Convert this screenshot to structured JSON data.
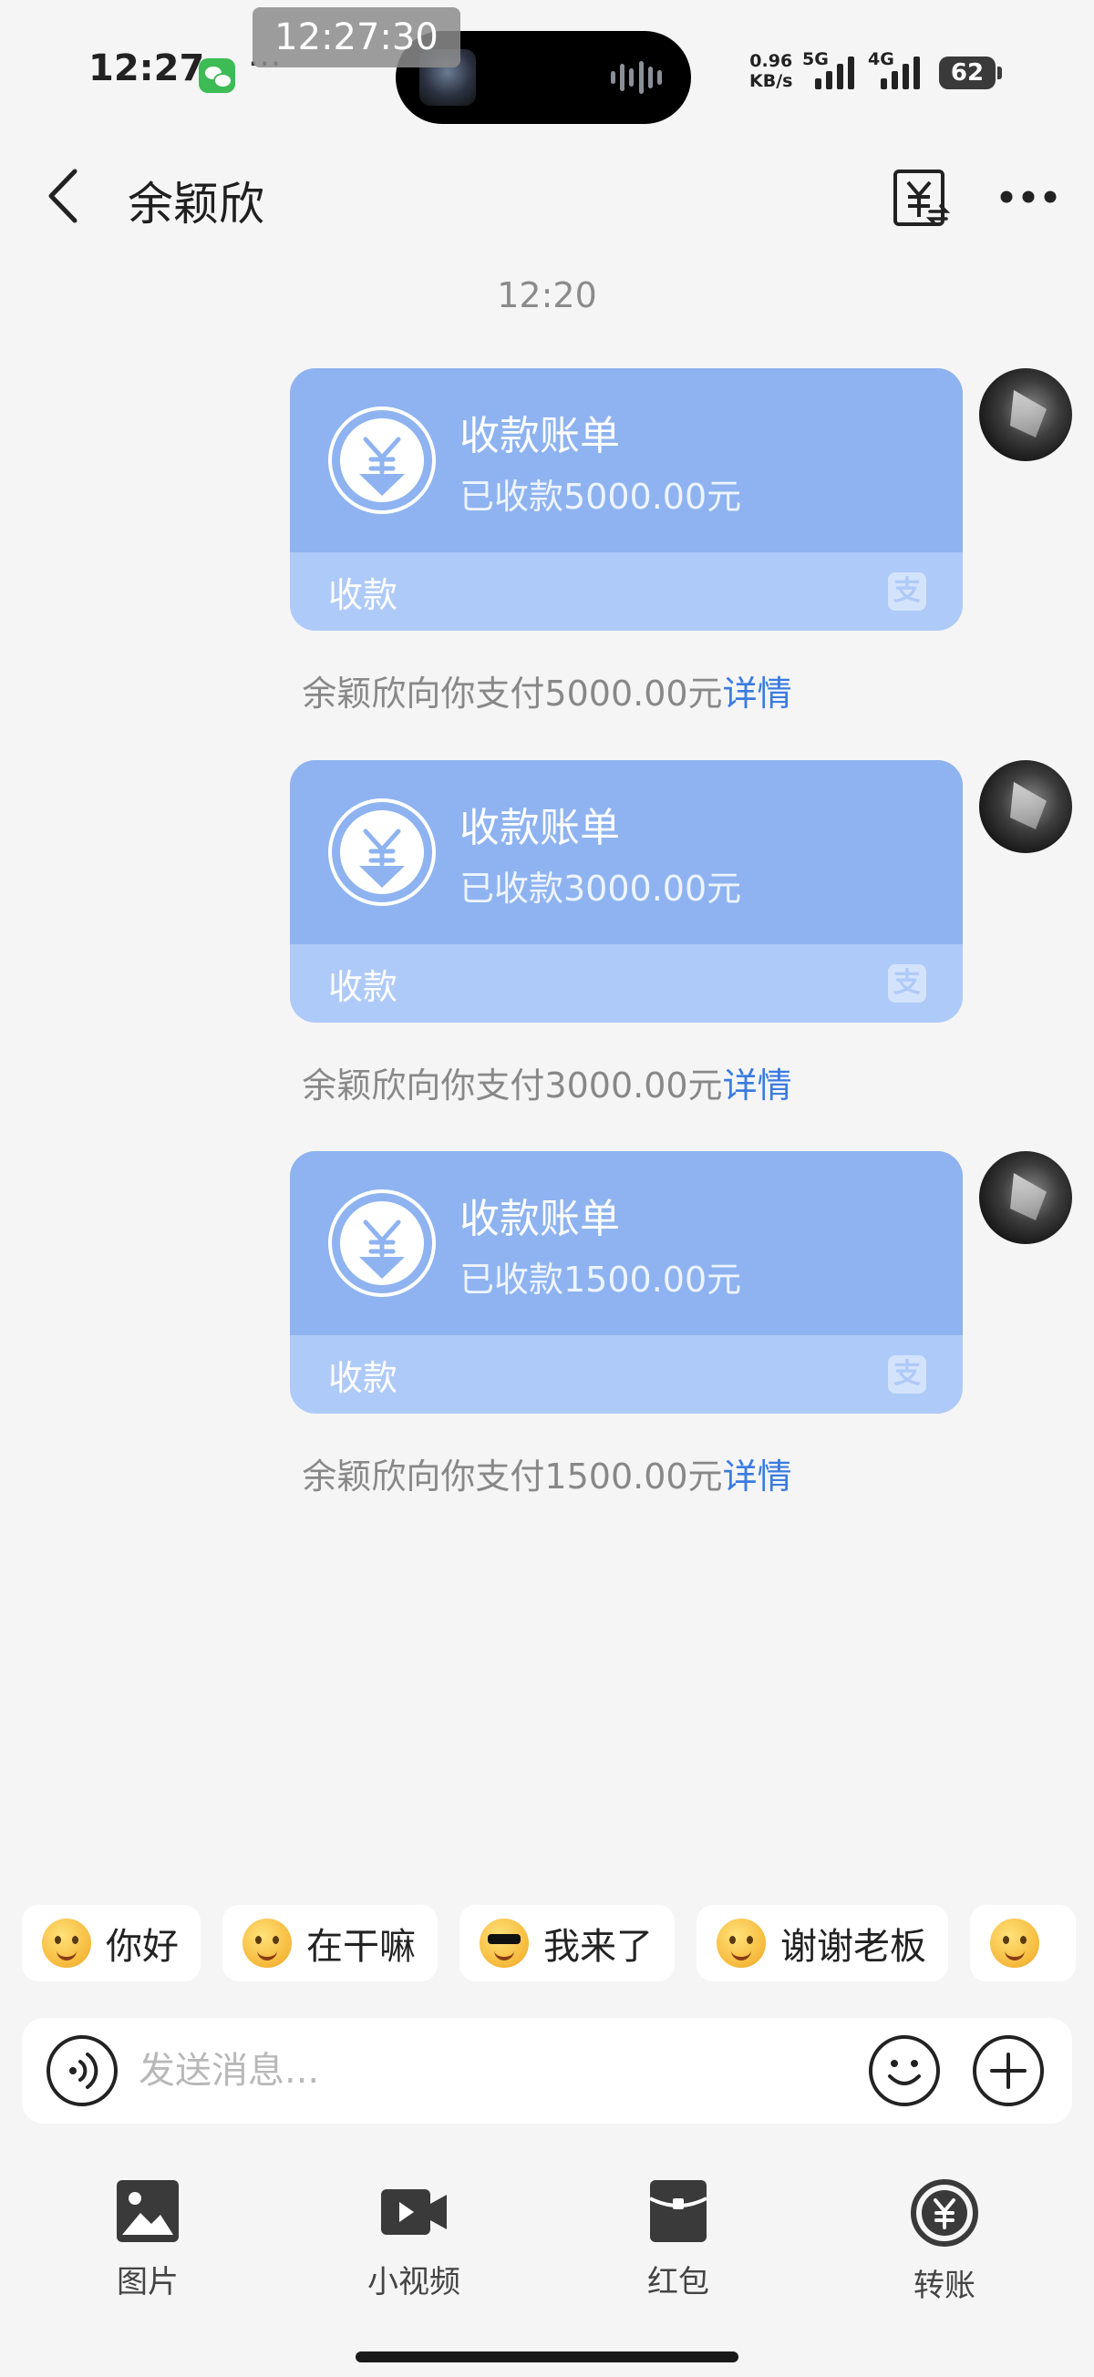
{
  "status_bar": {
    "time": "12:27",
    "overlay_time": "12:27:30",
    "more_dots": "···",
    "net_speed_value": "0.96",
    "net_speed_unit": "KB/s",
    "network_5g": "5G",
    "network_4g": "4G",
    "battery": "62"
  },
  "header": {
    "title": "余颖欣"
  },
  "chat": {
    "time_divider": "12:20",
    "messages": [
      {
        "card_title": "收款账单",
        "amount_text": "已收款5000.00元",
        "footer_label": "收款",
        "note_text": "余颖欣向你支付5000.00元",
        "note_link": "详情"
      },
      {
        "card_title": "收款账单",
        "amount_text": "已收款3000.00元",
        "footer_label": "收款",
        "note_text": "余颖欣向你支付3000.00元",
        "note_link": "详情"
      },
      {
        "card_title": "收款账单",
        "amount_text": "已收款1500.00元",
        "footer_label": "收款",
        "note_text": "余颖欣向你支付1500.00元",
        "note_link": "详情"
      }
    ]
  },
  "quick_replies": [
    "你好",
    "在干嘛",
    "我来了",
    "谢谢老板"
  ],
  "input": {
    "placeholder": "发送消息..."
  },
  "toolbar": {
    "items": [
      {
        "label": "图片",
        "icon": "image-icon"
      },
      {
        "label": "小视频",
        "icon": "video-icon"
      },
      {
        "label": "红包",
        "icon": "red-packet-icon"
      },
      {
        "label": "转账",
        "icon": "transfer-icon"
      }
    ]
  },
  "colors": {
    "card_top": "#8eb3f0",
    "card_bottom": "#aecaf8",
    "link": "#3a7be0",
    "background": "#f5f5f5"
  }
}
